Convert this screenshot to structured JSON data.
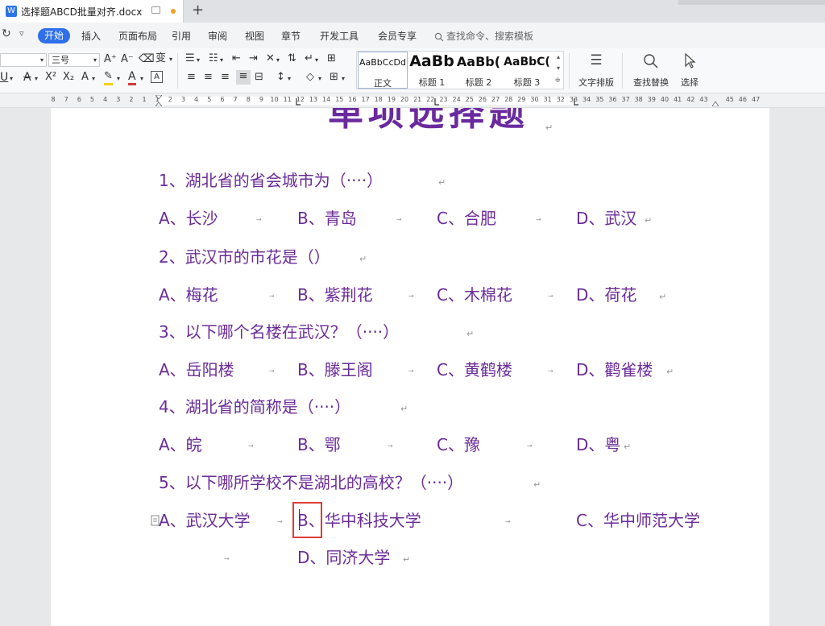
{
  "tab": {
    "title": "选择题ABCD批量对齐.docx",
    "doc_icon": "W"
  },
  "menu": {
    "items": [
      "开始",
      "插入",
      "页面布局",
      "引用",
      "审阅",
      "视图",
      "章节",
      "开发工具",
      "会员专享"
    ],
    "search_placeholder": "查找命令、搜索模板"
  },
  "ribbon": {
    "font_size": "三号",
    "grow_font": "A⁺",
    "shrink_font": "A⁻",
    "styles": [
      {
        "preview": "AaBbCcDd",
        "name": "正文"
      },
      {
        "preview": "AaBb",
        "name": "标题 1"
      },
      {
        "preview": "AaBb(",
        "name": "标题 2"
      },
      {
        "preview": "AaBbC(",
        "name": "标题 3"
      }
    ],
    "text_layout": "文字排版",
    "find_replace": "查找替换",
    "select": "选择"
  },
  "ruler": {
    "numbers": [
      "8",
      "7",
      "6",
      "5",
      "4",
      "3",
      "2",
      "1",
      "1",
      "2",
      "3",
      "4",
      "5",
      "6",
      "7",
      "8",
      "9",
      "10",
      "11",
      "12",
      "13",
      "14",
      "15",
      "16",
      "17",
      "18",
      "19",
      "20",
      "21",
      "22",
      "23",
      "24",
      "25",
      "26",
      "27",
      "28",
      "29",
      "30",
      "31",
      "32",
      "33",
      "34",
      "35",
      "36",
      "37",
      "38",
      "39",
      "40",
      "41",
      "42",
      "43",
      "45",
      "46",
      "47"
    ]
  },
  "document": {
    "title": "单项选择题",
    "lines": [
      "1、湖北省的省会城市为（····）",
      "A、长沙",
      "B、青岛",
      "C、合肥",
      "D、武汉",
      "2、武汉市的市花是（）",
      "A、梅花",
      "B、紫荆花",
      "C、木棉花",
      "D、荷花",
      "3、以下哪个名楼在武汉？（····）",
      "A、岳阳楼",
      "B、滕王阁",
      "C、黄鹤楼",
      "D、鹳雀楼",
      "4、湖北省的简称是（····）",
      "A、皖",
      "B、鄂",
      "C、豫",
      "D、粤",
      "5、以下哪所学校不是湖北的高校？（····）",
      "A、武汉大学",
      "B、华中科技大学",
      "C、华中师范大学",
      "D、同济大学"
    ]
  }
}
